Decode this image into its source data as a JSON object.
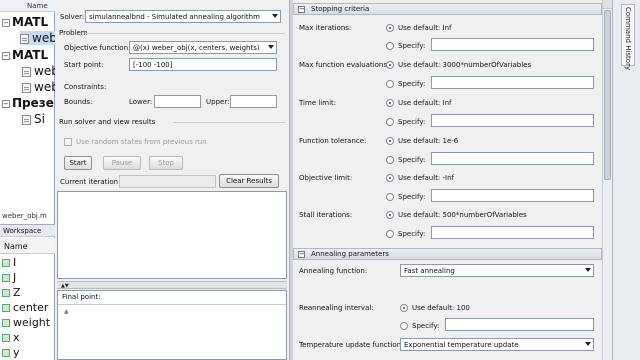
{
  "left_panel": {
    "header": "Name",
    "tree": [
      {
        "label": "MATL",
        "bold": true
      },
      {
        "label": "webe",
        "bold": false
      },
      {
        "label": "MATL",
        "bold": true
      },
      {
        "label": "webe",
        "bold": false
      },
      {
        "label": "webe",
        "bold": false
      },
      {
        "label": "Презе",
        "bold": true
      },
      {
        "label": "Si",
        "bold": false
      }
    ],
    "file_tab": "weber_obj.m",
    "workspace_title": "Workspace",
    "workspace_col": "Name",
    "workspace_vars": [
      "I",
      "J",
      "Z",
      "center",
      "weight",
      "x",
      "y"
    ]
  },
  "problem": {
    "solver_label": "Solver:",
    "solver_value": "simulannealbnd - Simulated annealing algorithm",
    "problem_title": "Problem",
    "objective_label": "Objective function:",
    "objective_value": "@(x) weber_obj(x, centers, weights)",
    "start_label": "Start point:",
    "start_value": "[-100 -100]",
    "constraints_title": "Constraints:",
    "bounds_label": "Bounds:",
    "lower_label": "Lower:",
    "upper_label": "Upper:",
    "run_title": "Run solver and view results",
    "random_states_label": "Use random states from previous run",
    "start_button": "Start",
    "pause_button": "Pause",
    "stop_button": "Stop",
    "iteration_label": "Current iteration:",
    "clear_button": "Clear Results",
    "final_point_label": "Final point:"
  },
  "options": {
    "stopping_title": "Stopping criteria",
    "rows": [
      {
        "label": "Max iterations:",
        "default": "Use default: Inf",
        "specify": "Specify:"
      },
      {
        "label": "Max function evaluations:",
        "default": "Use default: 3000*numberOfVariables",
        "specify": "Specify:"
      },
      {
        "label": "Time limit:",
        "default": "Use default: Inf",
        "specify": "Specify:"
      },
      {
        "label": "Function tolerance:",
        "default": "Use default: 1e-6",
        "specify": "Specify:"
      },
      {
        "label": "Objective limit:",
        "default": "Use default: -Inf",
        "specify": "Specify:"
      },
      {
        "label": "Stall iterations:",
        "default": "Use default: 500*numberOfVariables",
        "specify": "Specify:"
      }
    ],
    "annealing_title": "Annealing parameters",
    "annealing_fn_label": "Annealing function:",
    "annealing_fn_value": "Fast annealing",
    "reannealing_label": "Reannealing interval:",
    "reannealing_default": "Use default: 100",
    "reannealing_specify": "Specify:",
    "temp_update_label": "Temperature update function:",
    "temp_update_value": "Exponential temperature update"
  },
  "side_tab": "Command History"
}
